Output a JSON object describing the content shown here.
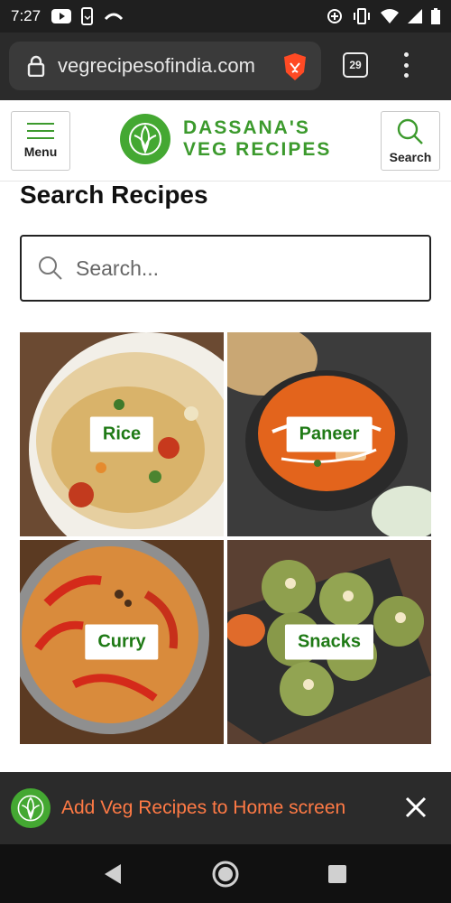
{
  "status_bar": {
    "time": "7:27"
  },
  "browser": {
    "url": "vegrecipesofindia.com",
    "tab_count": "29"
  },
  "site": {
    "menu_label": "Menu",
    "search_label": "Search",
    "logo_line1": "DASSANA'S",
    "logo_line2": "VEG RECIPES"
  },
  "search_section": {
    "title": "Search Recipes",
    "placeholder": "Search..."
  },
  "categories": [
    {
      "label": "Rice"
    },
    {
      "label": "Paneer"
    },
    {
      "label": "Curry"
    },
    {
      "label": "Snacks"
    }
  ],
  "install_banner": {
    "text": "Add Veg Recipes to Home screen"
  },
  "colors": {
    "brand_green": "#3c9a2d",
    "install_text": "#ff7a45"
  }
}
